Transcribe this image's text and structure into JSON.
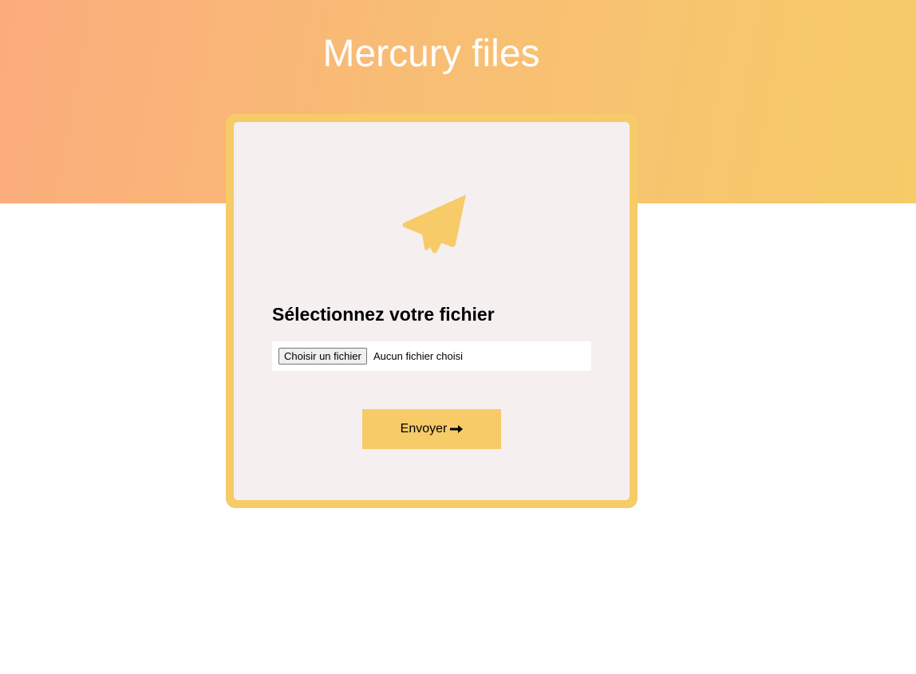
{
  "header": {
    "title": "Mercury files"
  },
  "upload_card": {
    "icon": "paper-plane-icon",
    "heading": "Sélectionnez votre fichier",
    "file_input": {
      "button_label": "Choisir un fichier",
      "status": "Aucun fichier choisi"
    },
    "submit": {
      "label": "Envoyer",
      "icon": "arrow-right-icon"
    }
  },
  "colors": {
    "gradient_start": "#fbac7c",
    "gradient_end": "#f6cb68",
    "accent": "#f6cb68",
    "card_background": "#f5eff0"
  }
}
